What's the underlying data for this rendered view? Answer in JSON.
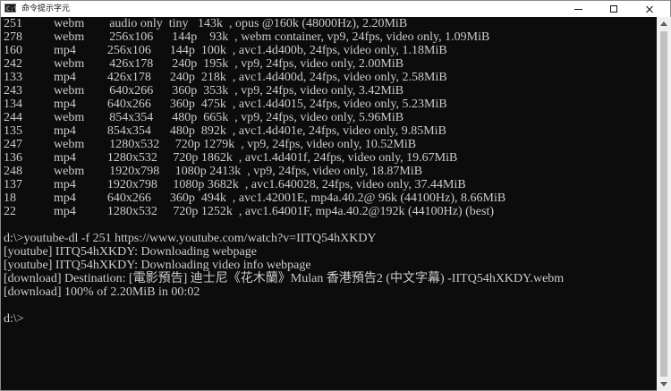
{
  "window": {
    "title": "命令提示字元",
    "icon_name": "cmd-icon",
    "icon_text": "C:\\"
  },
  "console": {
    "lines": [
      "251          webm        audio only  tiny   143k  , opus @160k (48000Hz), 2.20MiB",
      "278          webm        256x106      144p    93k  , webm container, vp9, 24fps, video only, 1.09MiB",
      "160          mp4          256x106      144p  100k  , avc1.4d400b, 24fps, video only, 1.18MiB",
      "242          webm        426x178      240p  195k  , vp9, 24fps, video only, 2.00MiB",
      "133          mp4          426x178      240p  218k  , avc1.4d400d, 24fps, video only, 2.58MiB",
      "243          webm        640x266      360p  353k  , vp9, 24fps, video only, 3.42MiB",
      "134          mp4          640x266      360p  475k  , avc1.4d4015, 24fps, video only, 5.23MiB",
      "244          webm        854x354      480p  665k  , vp9, 24fps, video only, 5.96MiB",
      "135          mp4          854x354      480p  892k  , avc1.4d401e, 24fps, video only, 9.85MiB",
      "247          webm        1280x532     720p 1279k  , vp9, 24fps, video only, 10.52MiB",
      "136          mp4          1280x532     720p 1862k  , avc1.4d401f, 24fps, video only, 19.67MiB",
      "248          webm        1920x798     1080p 2413k  , vp9, 24fps, video only, 18.87MiB",
      "137          mp4          1920x798     1080p 3682k  , avc1.640028, 24fps, video only, 37.44MiB",
      "18            mp4          640x266      360p  494k  , avc1.42001E, mp4a.40.2@ 96k (44100Hz), 8.66MiB",
      "22            mp4          1280x532     720p 1252k  , avc1.64001F, mp4a.40.2@192k (44100Hz) (best)",
      "",
      "d:\\>youtube-dl -f 251 https://www.youtube.com/watch?v=IITQ54hXKDY",
      "[youtube] IITQ54hXKDY: Downloading webpage",
      "[youtube] IITQ54hXKDY: Downloading video info webpage",
      "[download] Destination: [電影預告] 迪士尼《花木蘭》Mulan 香港預告2 (中文字幕) -IITQ54hXKDY.webm",
      "[download] 100% of 2.20MiB in 00:02",
      "",
      "d:\\>"
    ]
  },
  "colors": {
    "console_background": "#0c0c0c",
    "console_text": "#cccccc",
    "titlebar_background": "#ffffff",
    "scrollbar_track": "#f0f0f0",
    "scrollbar_thumb": "#c1c1c1"
  },
  "icons": {
    "minimize": "minimize-icon",
    "maximize": "maximize-icon",
    "close": "close-icon",
    "scroll_up": "chevron-up-icon",
    "scroll_down": "chevron-down-icon"
  }
}
